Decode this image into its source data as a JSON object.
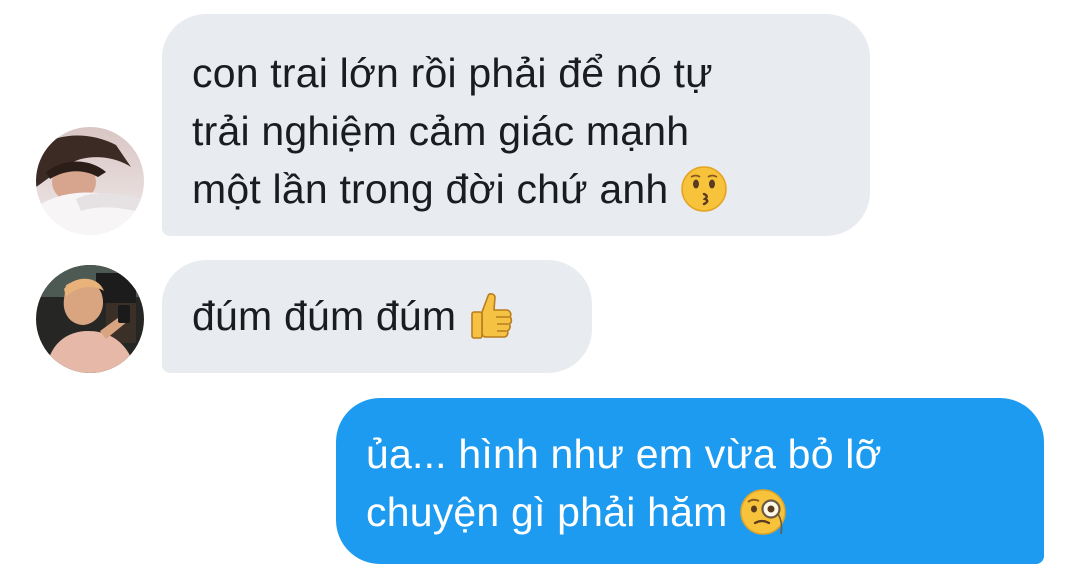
{
  "conversation": {
    "messages": [
      {
        "sender": "incoming",
        "lines": [
          "con trai lớn rồi phải để nó tự",
          "trải nghiệm cảm giác mạnh",
          "một lần trong đời chứ anh"
        ],
        "emoji": "kissing-face-icon"
      },
      {
        "sender": "incoming",
        "lines": [
          "đúm đúm đúm"
        ],
        "emoji": "thumbs-up-icon"
      },
      {
        "sender": "outgoing",
        "lines": [
          "ủa... hình như em vừa bỏ lỡ",
          "chuyện gì phải hăm"
        ],
        "emoji": "face-with-monocle-icon"
      }
    ]
  },
  "colors": {
    "incoming_bubble": "#e8ebef",
    "outgoing_bubble": "#1d9bf0",
    "incoming_text": "#1a1c1f",
    "outgoing_text": "#ffffff",
    "background": "#ffffff"
  }
}
